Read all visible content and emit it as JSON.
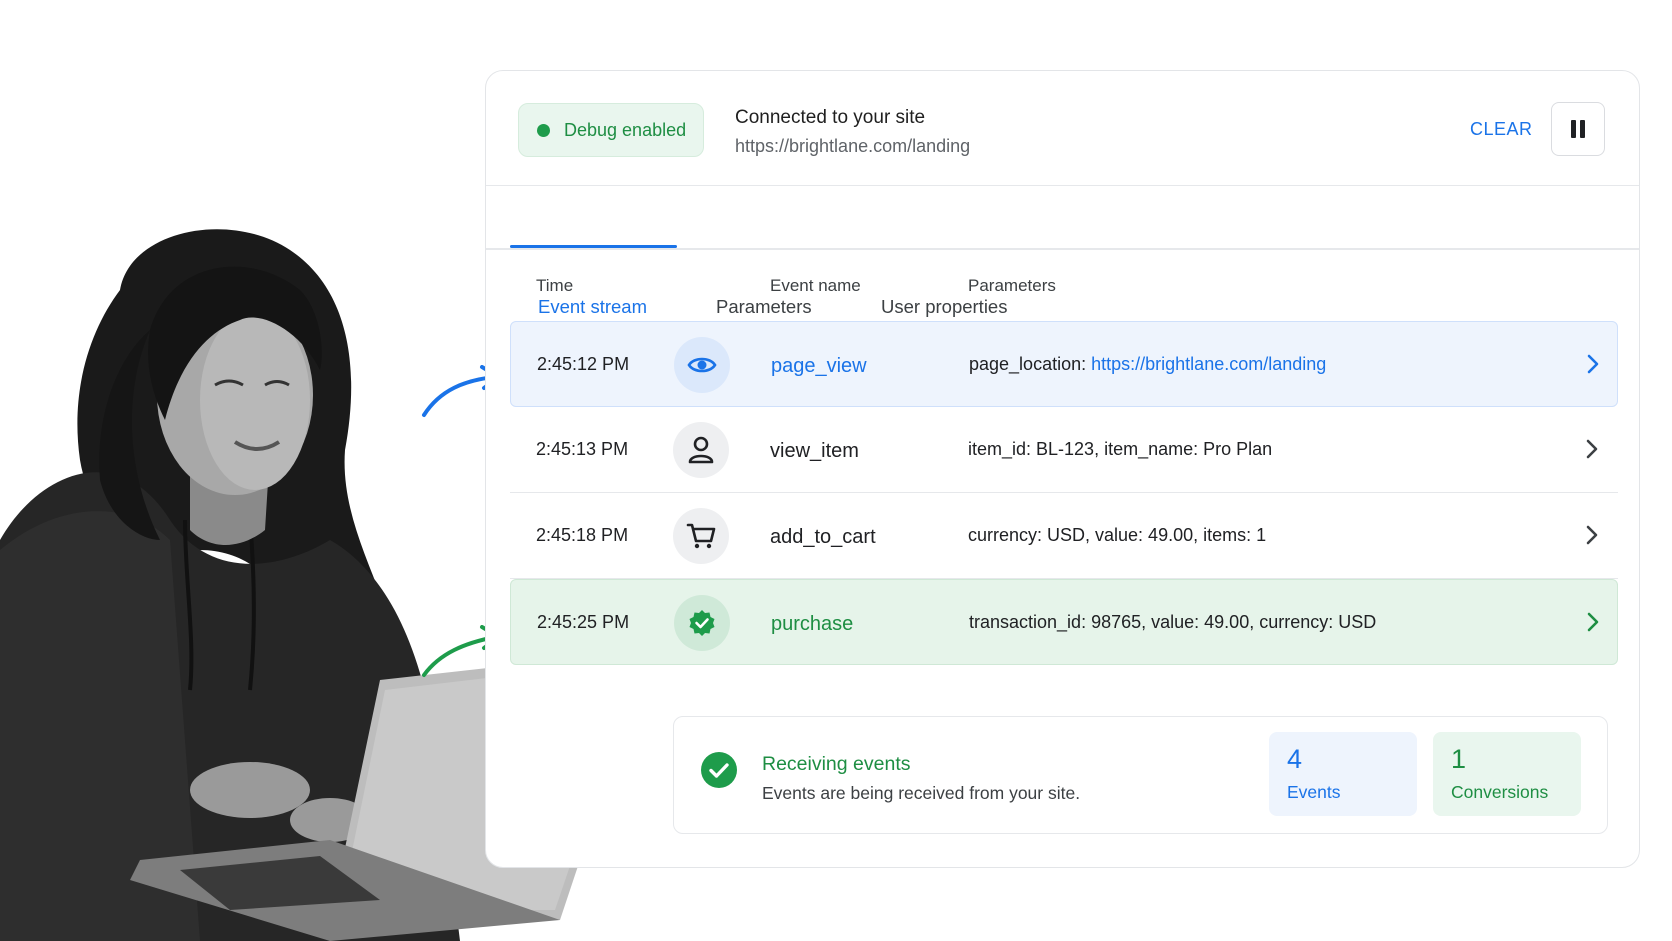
{
  "header": {
    "debug_label": "Debug enabled",
    "connection_title": "Connected to your site",
    "connection_url": "https://brightlane.com/landing",
    "clear_label": "CLEAR"
  },
  "tabs": [
    {
      "label": "Event stream",
      "active": true
    },
    {
      "label": "Parameters",
      "active": false
    },
    {
      "label": "User properties",
      "active": false
    }
  ],
  "columns": {
    "time": "Time",
    "event": "Event name",
    "params": "Parameters"
  },
  "events": [
    {
      "time": "2:45:12 PM",
      "name": "page_view",
      "params_key": "page_location:",
      "params_value": "https://brightlane.com/landing",
      "icon": "eye-icon",
      "highlight": "blue"
    },
    {
      "time": "2:45:13 PM",
      "name": "view_item",
      "params": "item_id: BL-123, item_name: Pro Plan",
      "icon": "person-icon",
      "highlight": "none"
    },
    {
      "time": "2:45:18 PM",
      "name": "add_to_cart",
      "params": "currency: USD, value: 49.00, items: 1",
      "icon": "cart-icon",
      "highlight": "none"
    },
    {
      "time": "2:45:25 PM",
      "name": "purchase",
      "params": "transaction_id: 98765, value: 49.00, currency: USD",
      "icon": "verified-badge-icon",
      "highlight": "green"
    }
  ],
  "summary": {
    "title": "Receiving events",
    "subtitle": "Events are being received from your site.",
    "events_count": "4",
    "events_label": "Events",
    "conversions_count": "1",
    "conversions_label": "Conversions"
  },
  "colors": {
    "accent_blue": "#1a73e8",
    "accent_green": "#1e8e43",
    "row_blue_bg": "#eef4fd",
    "row_green_bg": "#e6f4ea"
  }
}
